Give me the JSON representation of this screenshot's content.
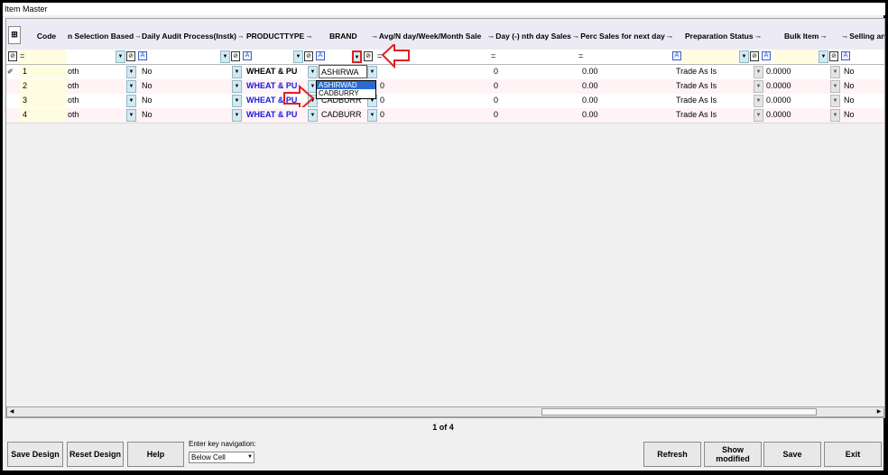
{
  "window": {
    "title": "Item Master"
  },
  "grid": {
    "columns": [
      {
        "label": "Code"
      },
      {
        "label": "n Selection Based"
      },
      {
        "label": "Daily Audit Process(Instk)"
      },
      {
        "label": "PRODUCTTYPE"
      },
      {
        "label": "BRAND"
      },
      {
        "label": "Avg/N day/Week/Month Sale"
      },
      {
        "label": "Day (-) nth day Sales"
      },
      {
        "label": "Perc Sales for next day"
      },
      {
        "label": "Preparation Status"
      },
      {
        "label": "Bulk Item"
      },
      {
        "label": "Selling an"
      }
    ],
    "filter_eq": "=",
    "rows": [
      {
        "code": "1",
        "sel": "oth",
        "audit": "No",
        "ptype": "WHEAT & PU",
        "brand": "ASHIRWA",
        "avg": "",
        "day": "0",
        "perc": "0.00",
        "prep": "Trade As Is",
        "bulk": "0.0000",
        "sell": "No"
      },
      {
        "code": "2",
        "sel": "oth",
        "audit": "No",
        "ptype": "WHEAT & PU",
        "brand": "",
        "avg": "0",
        "day": "0",
        "perc": "0.00",
        "prep": "Trade As Is",
        "bulk": "0.0000",
        "sell": "No"
      },
      {
        "code": "3",
        "sel": "oth",
        "audit": "No",
        "ptype": "WHEAT & PU",
        "brand": "CADBURR",
        "avg": "0",
        "day": "0",
        "perc": "0.00",
        "prep": "Trade As Is",
        "bulk": "0.0000",
        "sell": "No"
      },
      {
        "code": "4",
        "sel": "oth",
        "audit": "No",
        "ptype": "WHEAT & PU",
        "brand": "CADBURR",
        "avg": "0",
        "day": "0",
        "perc": "0.00",
        "prep": "Trade As Is",
        "bulk": "0.0000",
        "sell": "No"
      }
    ],
    "brand_dropdown": [
      "ASHIRWAD",
      "CADBURRY"
    ]
  },
  "pager": {
    "text": "1 of 4"
  },
  "keynav": {
    "label": "Enter key navigation:",
    "value": "Below Cell"
  },
  "buttons": {
    "save_design": "Save Design",
    "reset_design": "Reset Design",
    "help": "Help",
    "refresh": "Refresh",
    "show_modified": "Show modified",
    "save": "Save",
    "exit": "Exit"
  },
  "colors": {
    "accent_arrow": "#e02020",
    "dropdown_selected": "#2a6bd2",
    "ptype_text": "#1a1adb"
  }
}
